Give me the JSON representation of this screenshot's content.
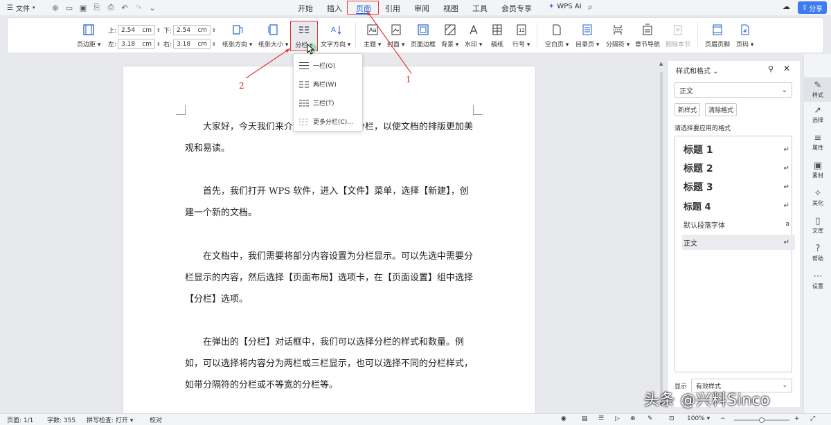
{
  "menu": {
    "file_label": "文件"
  },
  "tabs": [
    "开始",
    "插入",
    "页面",
    "引用",
    "审阅",
    "视图",
    "工具",
    "会员专享"
  ],
  "active_tab": "页面",
  "wps_ai_label": "WPS AI",
  "share_label": "分享",
  "ribbon": {
    "margins_label": "页边距",
    "top_label": "上:",
    "top_value": "2.54",
    "bottom_label": "下:",
    "bottom_value": "2.54",
    "left_label": "左:",
    "left_value": "3.18",
    "right_label": "右:",
    "right_value": "3.18",
    "unit": "cm",
    "orientation_label": "纸张方向",
    "size_label": "纸张大小",
    "columns_label": "分栏",
    "text_direction_label": "文字方向",
    "theme_label": "主题",
    "cover_label": "封面",
    "page_border_label": "页面边框",
    "background_label": "背景",
    "watermark_label": "水印",
    "draft_label": "稿纸",
    "line_numbers_label": "行号",
    "blank_page_label": "空白页",
    "toc_page_label": "目录页",
    "break_label": "分隔符",
    "section_nav_label": "章节导航",
    "delete_section_label": "删除本节",
    "header_footer_label": "页眉页脚",
    "page_number_label": "页码"
  },
  "dropdown": {
    "items": [
      "一栏(O)",
      "两栏(W)",
      "三栏(T)",
      "更多分栏(C)..."
    ]
  },
  "document": {
    "paragraphs": [
      "大家好，今天我们来介绍一下如何设置分栏，以使文档的排版更加美观和易读。",
      "首先，我们打开 WPS 软件，进入【文件】菜单，选择【新建】，创建一个新的文档。",
      "在文档中，我们需要将部分内容设置为分栏显示。可以先选中需要分栏显示的内容，然后选择【页面布局】选项卡，在【页面设置】组中选择【分栏】选项。",
      "在弹出的【分栏】对话框中，我们可以选择分栏的样式和数量。例如，可以选择将内容分为两栏或三栏显示，也可以选择不同的分栏样式，如带分隔符的分栏或不等宽的分栏等。"
    ]
  },
  "annotations": {
    "one": "1",
    "two": "2"
  },
  "style_panel": {
    "title": "样式和格式",
    "current_style": "正文",
    "new_style_button": "新样式",
    "clear_format_button": "清除格式",
    "apply_prompt": "请选择要应用的格式",
    "styles": [
      "标题 1",
      "标题 2",
      "标题 3",
      "标题 4",
      "默认段落字体",
      "正文"
    ],
    "show_label": "显示",
    "show_value": "有效样式"
  },
  "right_sidebar": [
    "样式",
    "选择",
    "属性",
    "素材",
    "美化",
    "文库",
    "帮助",
    "设置"
  ],
  "status": {
    "page": "页面: 1/1",
    "word_count": "字数: 355",
    "spell_check": "拼写检查: 打开",
    "proofread": "校对",
    "zoom": "100%"
  },
  "watermark_text": "头条 @兴料Sinco"
}
